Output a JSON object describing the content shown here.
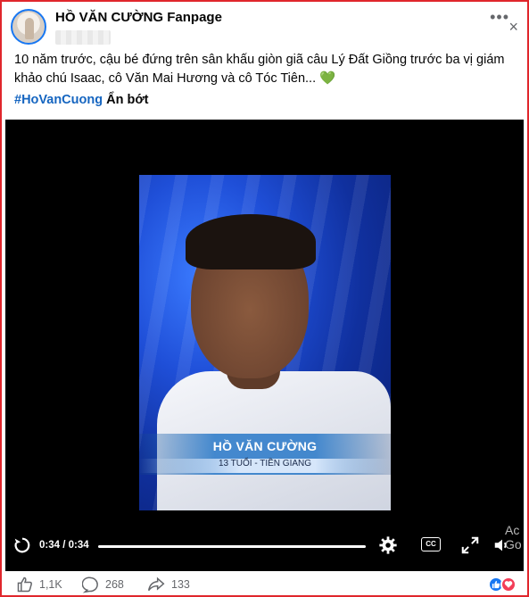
{
  "post": {
    "page_name": "HỒ VĂN CƯỜNG Fanpage",
    "caption": "10 năm trước, cậu bé đứng trên sân khấu giòn giã câu Lý Đất Giồng trước ba vị giám khảo chú Isaac, cô Văn Mai Hương và cô Tóc Tiên... 💚",
    "hashtag": "#HoVanCuong",
    "see_less": "Ẩn bớt",
    "more_icon": "•••",
    "close_icon": "×"
  },
  "video": {
    "lower_third_name": "HỒ VĂN CƯỜNG",
    "lower_third_sub": "13 TUỔI - TIỀN GIANG",
    "time": "0:34 / 0:34",
    "progress": 1.0,
    "cc_label": "CC",
    "watermark": "Ac\nGo"
  },
  "footer": {
    "likes": "1,1K",
    "comments": "268",
    "shares": "133"
  },
  "colors": {
    "border": "#e0262c",
    "hashtag": "#1565c0",
    "like": "#1877f2",
    "love": "#f33e58"
  },
  "icons": [
    "more-icon",
    "close-icon",
    "replay-icon",
    "settings-gear-icon",
    "closed-captions-icon",
    "expand-icon",
    "volume-icon",
    "like-icon",
    "comment-icon",
    "share-icon",
    "like-reaction-icon",
    "love-reaction-icon"
  ]
}
